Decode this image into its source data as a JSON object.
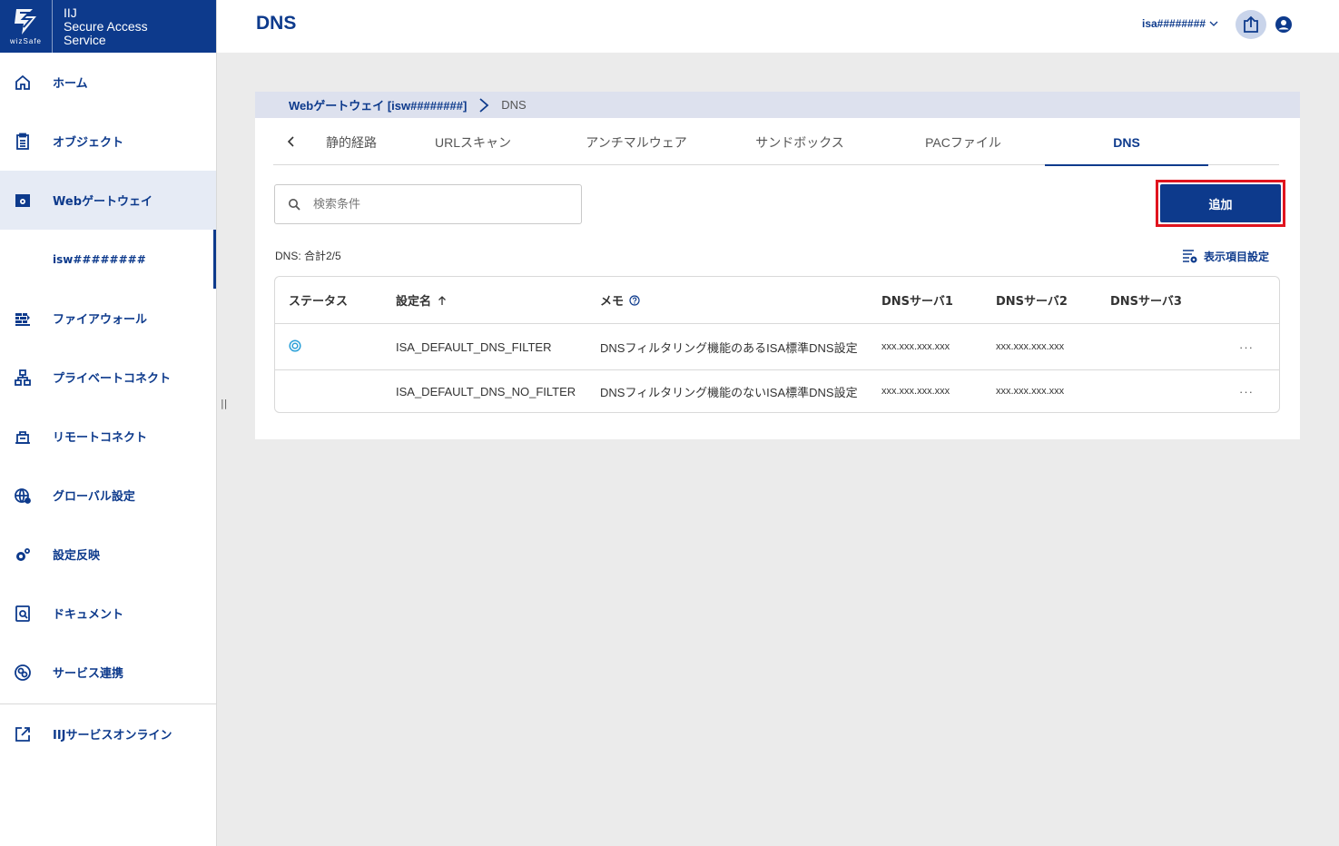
{
  "brand": {
    "logo_text": "wizSafe",
    "line1": "IIJ",
    "line2": "Secure Access",
    "line3": "Service"
  },
  "sidebar": {
    "items": [
      {
        "label": "ホーム"
      },
      {
        "label": "オブジェクト"
      },
      {
        "label": "Webゲートウェイ"
      },
      {
        "label": "ファイアウォール"
      },
      {
        "label": "プライベートコネクト"
      },
      {
        "label": "リモートコネクト"
      },
      {
        "label": "グローバル設定"
      },
      {
        "label": "設定反映"
      },
      {
        "label": "ドキュメント"
      },
      {
        "label": "サービス連携"
      },
      {
        "label": "IIJサービスオンライン"
      }
    ],
    "sub_item": "isw########",
    "collapse_handle": "||"
  },
  "header": {
    "title": "DNS",
    "user": "isa########"
  },
  "breadcrumb": {
    "parent": "Webゲートウェイ [isw########]",
    "current": "DNS"
  },
  "tabs": [
    "静的経路",
    "URLスキャン",
    "アンチマルウェア",
    "サンドボックス",
    "PACファイル",
    "DNS"
  ],
  "search": {
    "placeholder": "検索条件",
    "value": ""
  },
  "add_button": "追加",
  "count_label": "DNS: 合計2/5",
  "column_settings": "表示項目設定",
  "table": {
    "headers": {
      "status": "ステータス",
      "name": "設定名",
      "memo": "メモ",
      "dns1": "DNSサーバ1",
      "dns2": "DNSサーバ2",
      "dns3": "DNSサーバ3"
    },
    "rows": [
      {
        "name": "ISA_DEFAULT_DNS_FILTER",
        "memo": "DNSフィルタリング機能のあるISA標準DNS設定",
        "dns1": "xxx.xxx.xxx.xxx",
        "dns2": "xxx.xxx.xxx.xxx",
        "dns3": "",
        "more": "···"
      },
      {
        "name": "ISA_DEFAULT_DNS_NO_FILTER",
        "memo": "DNSフィルタリング機能のないISA標準DNS設定",
        "dns1": "xxx.xxx.xxx.xxx",
        "dns2": "xxx.xxx.xxx.xxx",
        "dns3": "",
        "more": "···"
      }
    ]
  },
  "colors": {
    "brand": "#0d3a8c",
    "highlight": "#e0141e",
    "status": "#2aa0d8"
  }
}
